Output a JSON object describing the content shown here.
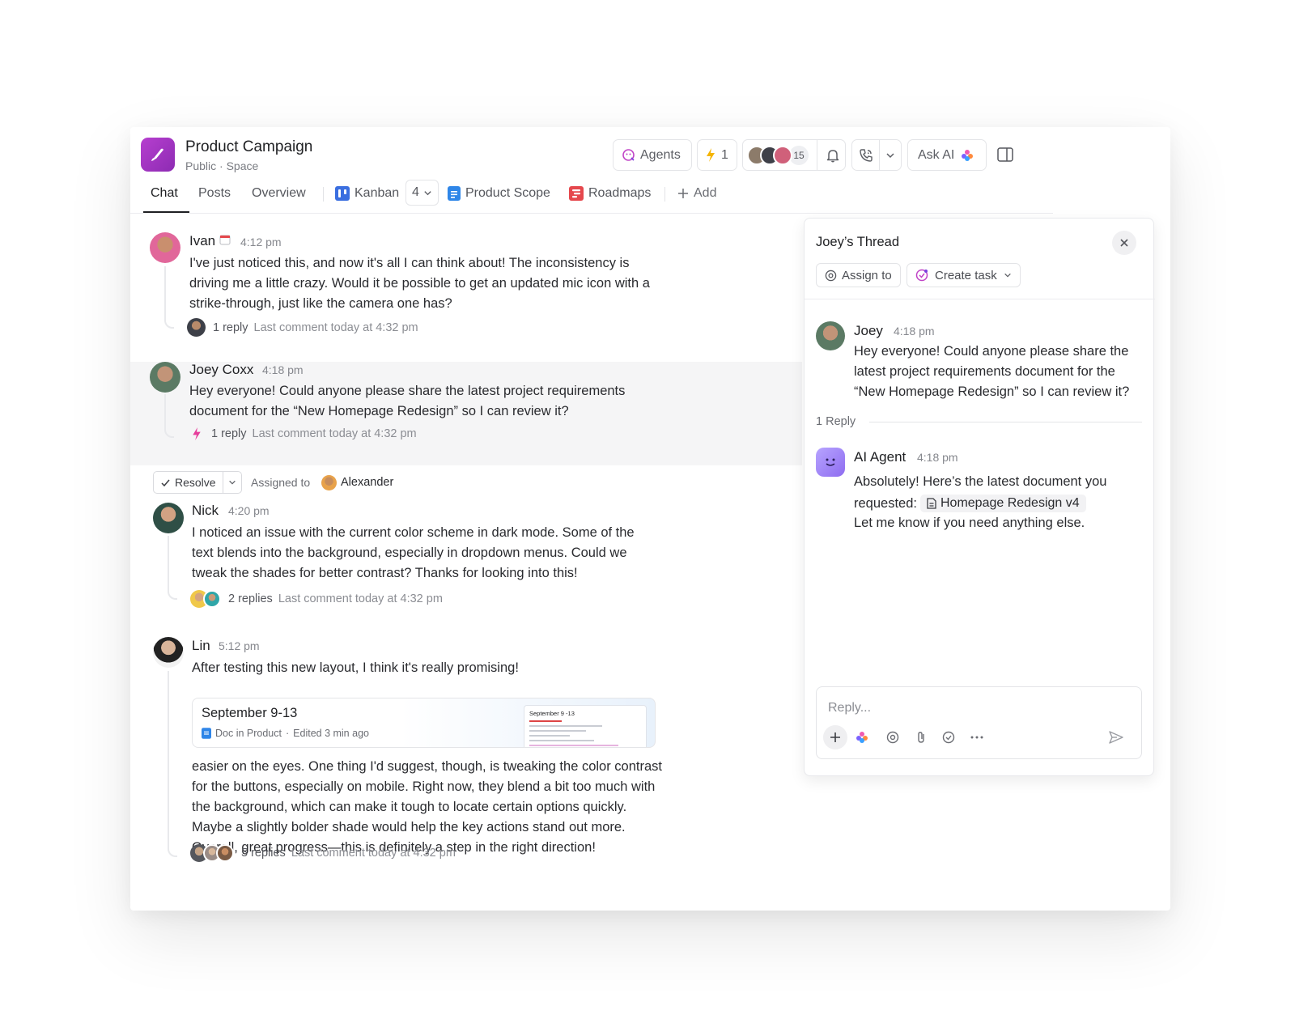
{
  "header": {
    "title": "Product Campaign",
    "subtitle": "Public · Space",
    "agents_label": "Agents",
    "automations_count": "1",
    "members_count": "15",
    "ask_ai_label": "Ask AI"
  },
  "tabs": [
    {
      "label": "Chat"
    },
    {
      "label": "Posts"
    },
    {
      "label": "Overview"
    },
    {
      "label": "Kanban"
    },
    {
      "label": "4"
    },
    {
      "label": "Product Scope"
    },
    {
      "label": "Roadmaps"
    },
    {
      "label": "Add"
    }
  ],
  "messages": [
    {
      "name": "Ivan",
      "time": "4:12 pm",
      "text": "I've just noticed this, and now it's all I can think about! The inconsistency is driving me a little crazy. Would it be possible to get an updated mic icon with a strike-through, just like the camera one has?",
      "reply_count": "1 reply",
      "last_comment": "Last comment today at 4:32 pm"
    },
    {
      "name": "Joey Coxx",
      "time": "4:18 pm",
      "text": "Hey everyone! Could anyone please share the latest project requirements document for the “New Homepage Redesign” so I can review it?",
      "reply_count": "1 reply",
      "last_comment": "Last comment today at 4:32 pm"
    },
    {
      "resolve_label": "Resolve",
      "assigned_label": "Assigned to",
      "assignee": "Alexander",
      "name": "Nick",
      "time": "4:20 pm",
      "text": "I noticed an issue with the current color scheme in dark mode. Some of the text blends into the background, especially in dropdown menus. Could we tweak the shades for better contrast? Thanks for looking into this!",
      "reply_count": "2 replies",
      "last_comment": "Last comment today at 4:32 pm"
    },
    {
      "name": "Lin",
      "time": "5:12 pm",
      "text_intro": "After testing this new layout, I think it's really promising!",
      "doc": {
        "title": "September 9-13",
        "meta_location": "Doc in Product",
        "meta_edited": "Edited 3 min ago",
        "thumb_title": "September 9 -13"
      },
      "text": "easier on the eyes. One thing I'd suggest, though, is tweaking the color contrast for the buttons, especially on mobile. Right now, they blend a bit too much with the background, which can make it tough to locate certain options quickly. Maybe a slightly bolder shade would help the key actions stand out more. Overall, great progress—this is definitely a step in the right direction!",
      "reply_count": "5 replies",
      "last_comment": "Last comment today at 4:32 pm"
    }
  ],
  "thread": {
    "title": "Joey’s Thread",
    "assign_label": "Assign to",
    "create_task_label": "Create task",
    "original": {
      "name": "Joey",
      "time": "4:18 pm",
      "text": "Hey everyone! Could anyone please share the latest project requirements document for the “New Homepage Redesign” so I can review it?"
    },
    "reply_divider": "1 Reply",
    "reply": {
      "name": "AI Agent",
      "time": "4:18 pm",
      "text_1": "Absolutely! Here’s the latest document you",
      "text_2": "requested:",
      "doc_chip": "Homepage Redesign v4",
      "text_3": "Let me know if you need anything else."
    },
    "composer_placeholder": "Reply..."
  },
  "colors": {
    "space_icon": "#a734c6",
    "kanban": "#3b6fe0",
    "product_scope": "#2f86e8",
    "roadmaps": "#e5484d",
    "automation": "#f5b400"
  }
}
